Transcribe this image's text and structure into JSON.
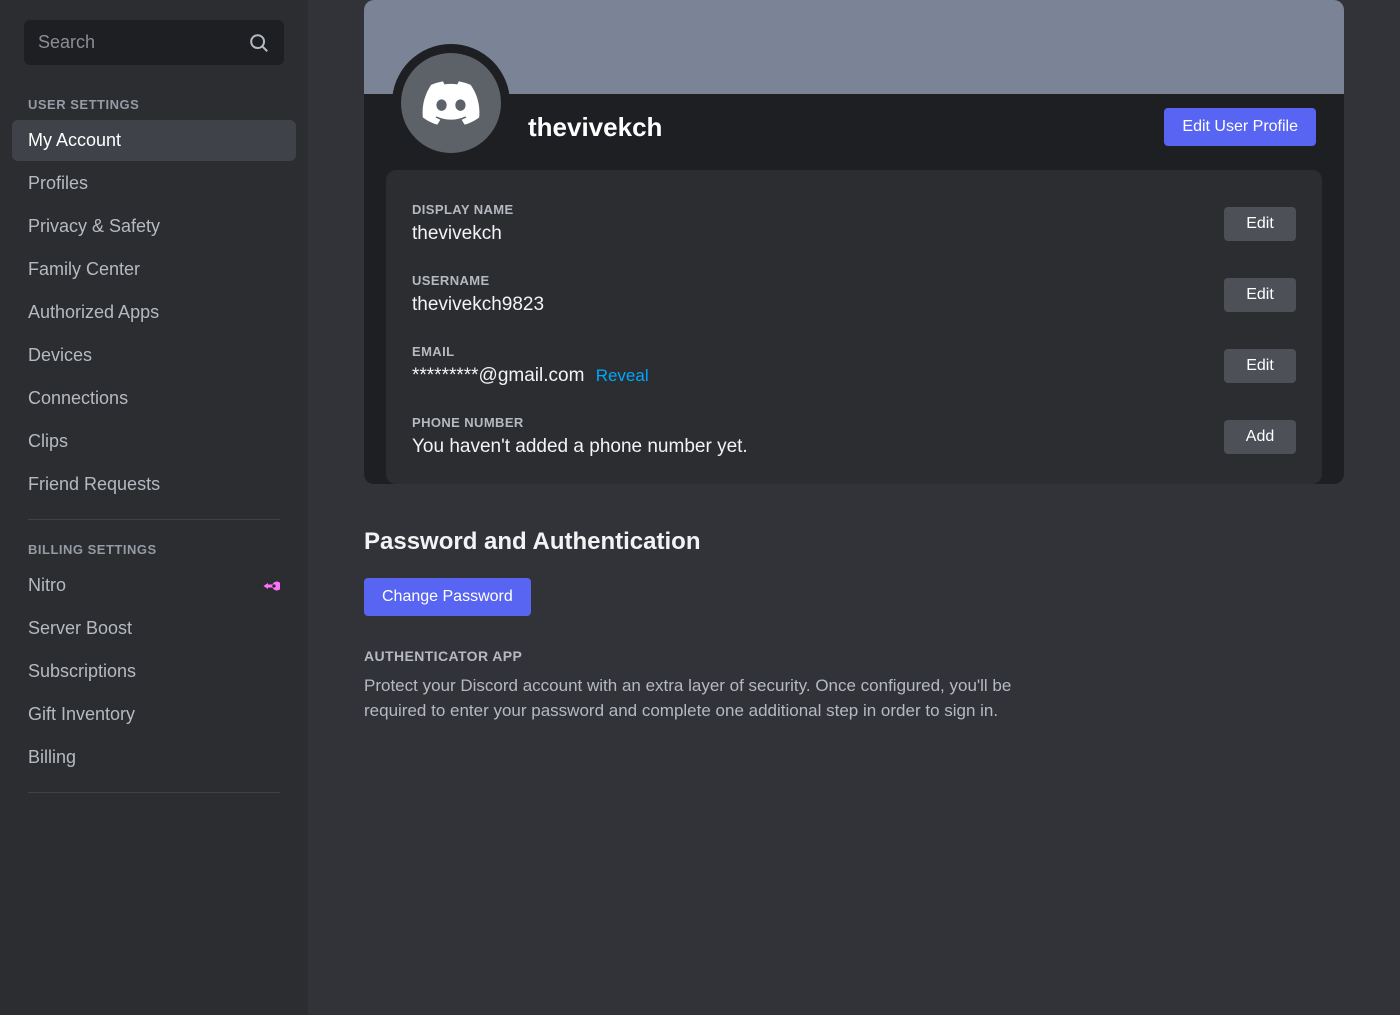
{
  "search": {
    "placeholder": "Search"
  },
  "sidebar": {
    "sections": [
      {
        "heading": "USER SETTINGS",
        "items": [
          {
            "label": "My Account",
            "active": true
          },
          {
            "label": "Profiles"
          },
          {
            "label": "Privacy & Safety"
          },
          {
            "label": "Family Center"
          },
          {
            "label": "Authorized Apps"
          },
          {
            "label": "Devices"
          },
          {
            "label": "Connections"
          },
          {
            "label": "Clips"
          },
          {
            "label": "Friend Requests"
          }
        ]
      },
      {
        "heading": "BILLING SETTINGS",
        "items": [
          {
            "label": "Nitro",
            "icon": "nitro"
          },
          {
            "label": "Server Boost"
          },
          {
            "label": "Subscriptions"
          },
          {
            "label": "Gift Inventory"
          },
          {
            "label": "Billing"
          }
        ]
      }
    ]
  },
  "profile": {
    "display_name": "thevivekch",
    "edit_profile_btn": "Edit User Profile",
    "fields": {
      "display_name": {
        "label": "DISPLAY NAME",
        "value": "thevivekch",
        "action": "Edit"
      },
      "username": {
        "label": "USERNAME",
        "value": "thevivekch9823",
        "action": "Edit"
      },
      "email": {
        "label": "EMAIL",
        "value": "*********@gmail.com",
        "reveal": "Reveal",
        "action": "Edit"
      },
      "phone": {
        "label": "PHONE NUMBER",
        "value": "You haven't added a phone number yet.",
        "action": "Add"
      }
    }
  },
  "auth": {
    "title": "Password and Authentication",
    "change_password_btn": "Change Password",
    "authenticator_label": "AUTHENTICATOR APP",
    "authenticator_desc": "Protect your Discord account with an extra layer of security. Once configured, you'll be required to enter your password and complete one additional step in order to sign in."
  }
}
